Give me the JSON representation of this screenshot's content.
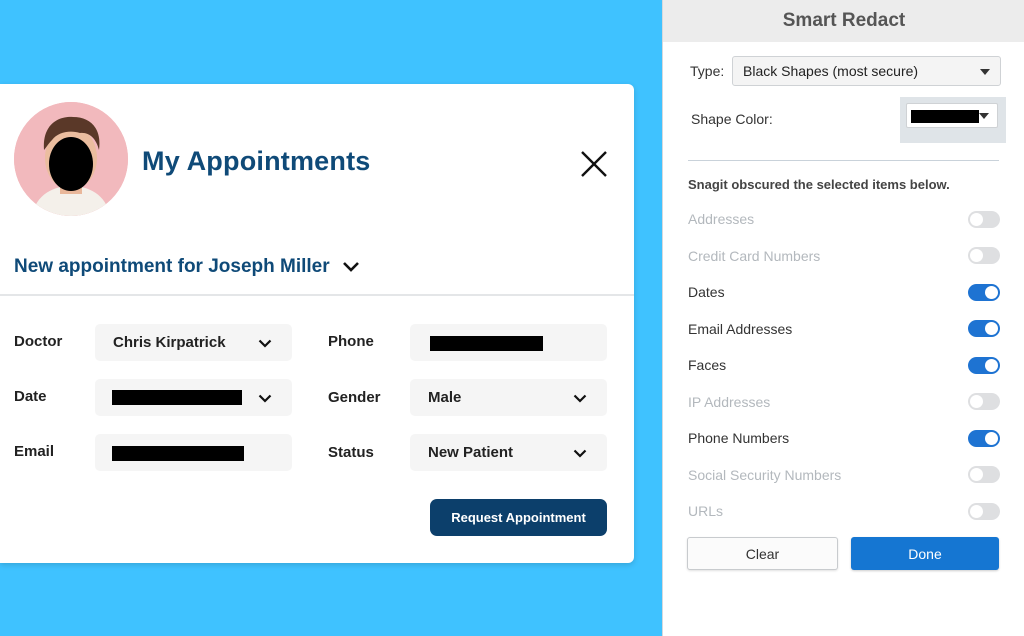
{
  "colors": {
    "background": "#3fc2ff",
    "brand_navy": "#0f4a78",
    "button_navy": "#0c3f6b",
    "toggle_on": "#1e73d2",
    "done_blue": "#1576d2"
  },
  "card": {
    "title": "My Appointments",
    "appointment_label": "New appointment for Joseph Miller",
    "fields": {
      "doctor": {
        "label": "Doctor",
        "value": "Chris Kirpatrick"
      },
      "phone": {
        "label": "Phone",
        "value": ""
      },
      "date": {
        "label": "Date",
        "value": ""
      },
      "gender": {
        "label": "Gender",
        "value": "Male"
      },
      "email": {
        "label": "Email",
        "value": ""
      },
      "status": {
        "label": "Status",
        "value": "New Patient"
      }
    },
    "request_button": "Request Appointment",
    "icons": {
      "close": "close-icon",
      "chevron": "chevron-down-icon",
      "avatar": "redacted-face-avatar"
    }
  },
  "panel": {
    "title": "Smart Redact",
    "type_label": "Type:",
    "type_value": "Black Shapes (most secure)",
    "shape_color_label": "Shape Color:",
    "shape_color": "#000000",
    "notice": "Snagit obscured the selected items below.",
    "options": [
      {
        "label": "Addresses",
        "enabled": false
      },
      {
        "label": "Credit Card Numbers",
        "enabled": false
      },
      {
        "label": "Dates",
        "enabled": true
      },
      {
        "label": "Email Addresses",
        "enabled": true
      },
      {
        "label": "Faces",
        "enabled": true
      },
      {
        "label": "IP Addresses",
        "enabled": false
      },
      {
        "label": "Phone Numbers",
        "enabled": true
      },
      {
        "label": "Social Security Numbers",
        "enabled": false
      },
      {
        "label": "URLs",
        "enabled": false
      }
    ],
    "clear_button": "Clear",
    "done_button": "Done"
  }
}
